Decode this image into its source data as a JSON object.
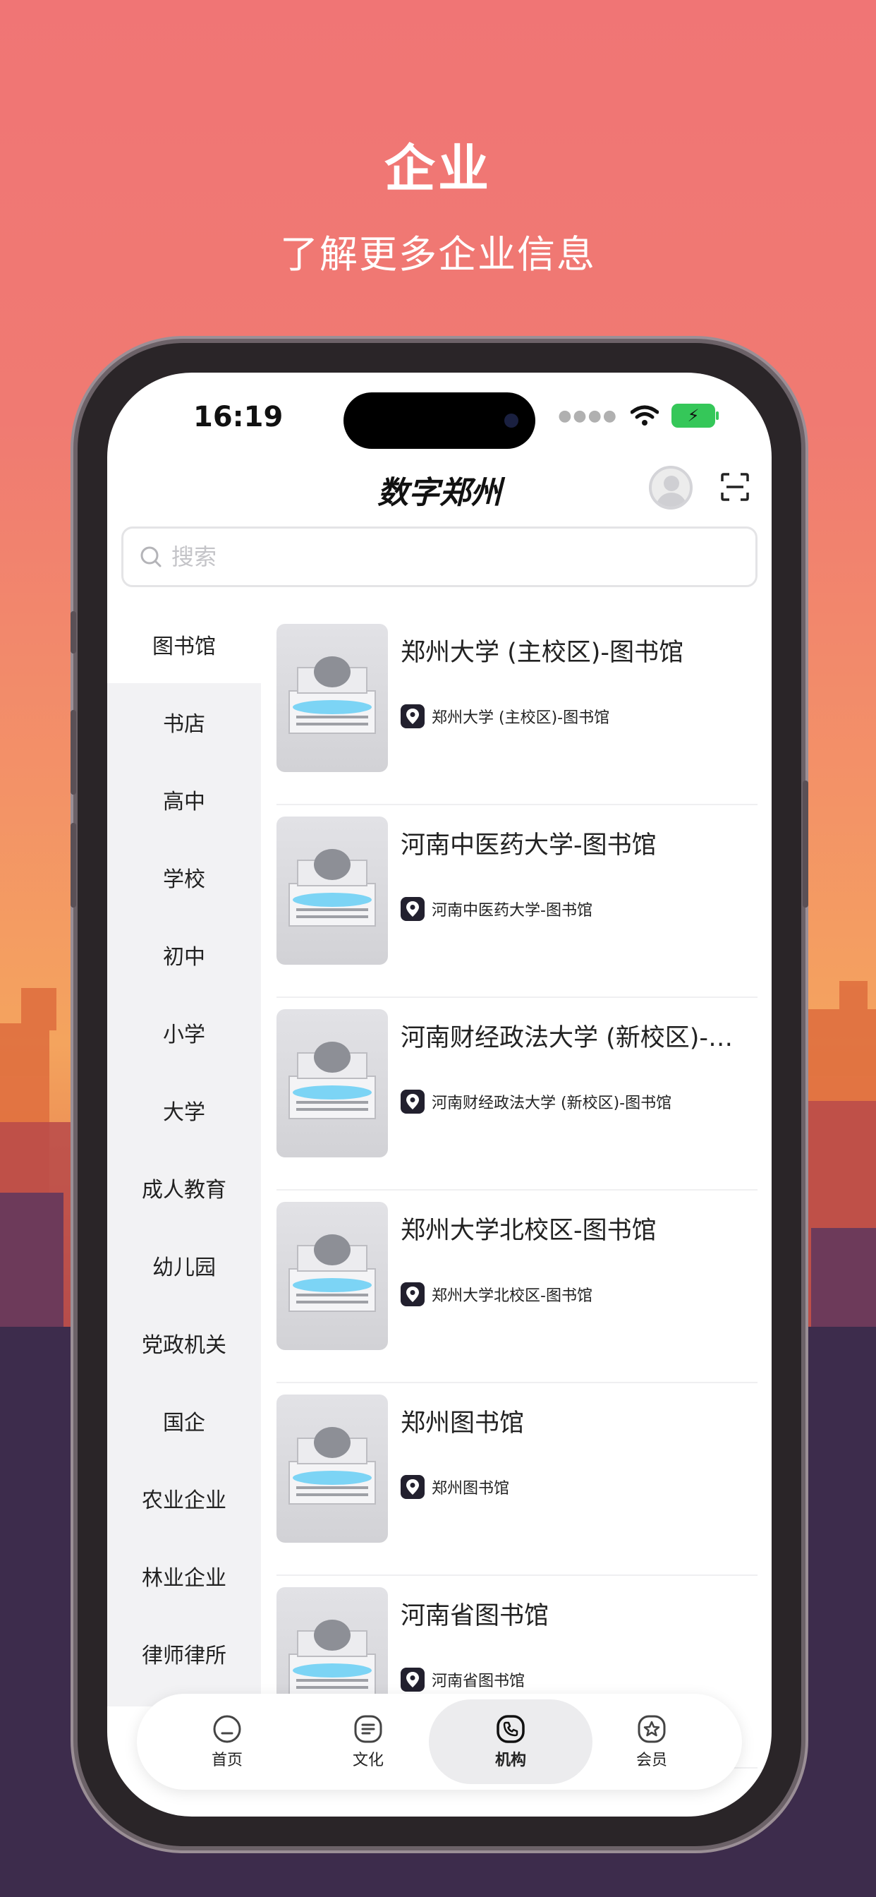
{
  "promo": {
    "title": "企业",
    "subtitle": "了解更多企业信息"
  },
  "status_bar": {
    "time": "16:19"
  },
  "header": {
    "app_title": "数字郑州"
  },
  "search": {
    "placeholder": "搜索"
  },
  "sidebar": {
    "items": [
      {
        "label": "图书馆",
        "active": true
      },
      {
        "label": "书店"
      },
      {
        "label": "高中"
      },
      {
        "label": "学校"
      },
      {
        "label": "初中"
      },
      {
        "label": "小学"
      },
      {
        "label": "大学"
      },
      {
        "label": "成人教育"
      },
      {
        "label": "幼儿园"
      },
      {
        "label": "党政机关"
      },
      {
        "label": "国企"
      },
      {
        "label": "农业企业"
      },
      {
        "label": "林业企业"
      },
      {
        "label": "律师律所"
      }
    ]
  },
  "list": {
    "items": [
      {
        "title": "郑州大学 (主校区)-图书馆",
        "subtitle": "郑州大学 (主校区)-图书馆"
      },
      {
        "title": "河南中医药大学-图书馆",
        "subtitle": "河南中医药大学-图书馆"
      },
      {
        "title": "河南财经政法大学 (新校区)-图书馆",
        "subtitle": "河南财经政法大学 (新校区)-图书馆"
      },
      {
        "title": "郑州大学北校区-图书馆",
        "subtitle": "郑州大学北校区-图书馆"
      },
      {
        "title": "郑州图书馆",
        "subtitle": "郑州图书馆"
      },
      {
        "title": "河南省图书馆",
        "subtitle": "河南省图书馆"
      }
    ]
  },
  "tabbar": {
    "tabs": [
      {
        "label": "首页",
        "icon": "home-icon"
      },
      {
        "label": "文化",
        "icon": "culture-icon"
      },
      {
        "label": "机构",
        "icon": "phone-icon",
        "active": true
      },
      {
        "label": "会员",
        "icon": "member-icon"
      }
    ]
  },
  "colors": {
    "background_top": "#f07575",
    "background_bottom": "#3b2a48",
    "battery": "#35c759"
  }
}
